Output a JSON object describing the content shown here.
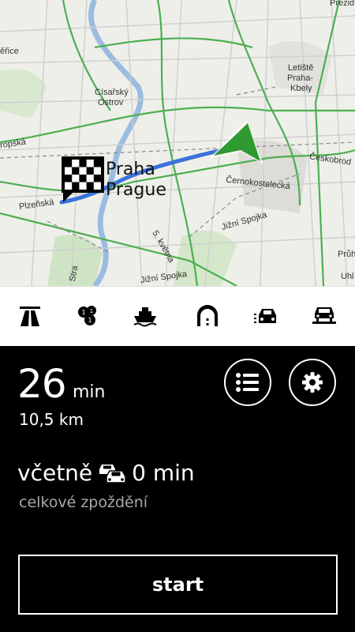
{
  "map": {
    "labels": {
      "prezid": "Prezid",
      "rice": "ěřice",
      "cisarsky": "Císařský",
      "ostrov": "Ostrov",
      "letiste": "Letiště",
      "praha_kbely_1": "Praha-",
      "praha_kbely_2": "Kbely",
      "opska": "ropská",
      "ceskobrod": "Českobrod",
      "cernokostelecka": "Černokostelecká",
      "plzenska": "Plzeňská",
      "jizni_spojka": "Jižní  Spojka",
      "s_kvetna": "5. května",
      "jizni_spojka_2": "Jižní  Spojka",
      "pruh": "Průh",
      "uhl": "Uhl",
      "stra": "Stra"
    },
    "city_name_cz": "Praha",
    "city_name_en": "Prague"
  },
  "toolbar": {
    "icons": [
      "motorway-icon",
      "toll-icon",
      "ferry-icon",
      "tunnel-icon",
      "traffic-icon",
      "car-train-icon"
    ]
  },
  "route": {
    "duration_value": "26",
    "duration_unit": "min",
    "distance": "10,5 km",
    "including_label": "včetně",
    "delay_value": "0 min",
    "delay_caption": "celkové zpoždění",
    "start_label": "start"
  },
  "colors": {
    "accent_green": "#2f9a2f",
    "route_blue": "#3a73d9",
    "road_green": "#4caf50",
    "background": "#000000"
  }
}
